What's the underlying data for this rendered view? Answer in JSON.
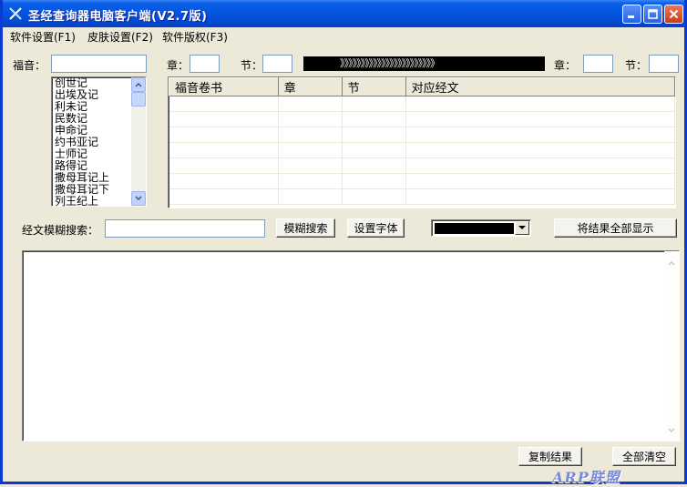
{
  "window": {
    "title": "圣经查询器电脑客户端(V2.7版)",
    "icons": {
      "app": "cross-icon",
      "minimize": "minimize-icon",
      "maximize": "maximize-icon",
      "close": "close-icon"
    }
  },
  "menu": {
    "items": [
      {
        "label": "软件设置(F1)"
      },
      {
        "label": "皮肤设置(F2)"
      },
      {
        "label": "软件版权(F3)"
      }
    ]
  },
  "search_row": {
    "gospel_label": "福音：",
    "gospel_value": "",
    "chapter_label": "章：",
    "chapter_value": "",
    "verse_label": "节：",
    "verse_value": "",
    "progress_text": "》》》》》》》》》》》》》》》》》》》》》》》",
    "chapter2_label": "章：",
    "chapter2_value": "",
    "verse2_label": "节：",
    "verse2_value": ""
  },
  "book_list": {
    "items": [
      "创世记",
      "出埃及记",
      "利未记",
      "民数记",
      "申命记",
      "约书亚记",
      "士师记",
      "路得记",
      "撒母耳记上",
      "撒母耳记下",
      "列王纪上"
    ]
  },
  "results_table": {
    "columns": [
      "福音卷书",
      "章",
      "节",
      "对应经文"
    ]
  },
  "fuzzy": {
    "label": "经文模糊搜索：",
    "value": "",
    "search_button": "模糊搜索",
    "font_button": "设置字体",
    "color_value": "#000000",
    "show_all_button": "将结果全部显示"
  },
  "footer": {
    "copy_button": "复制结果",
    "clear_button": "全部清空",
    "watermark": "ARP联盟"
  }
}
